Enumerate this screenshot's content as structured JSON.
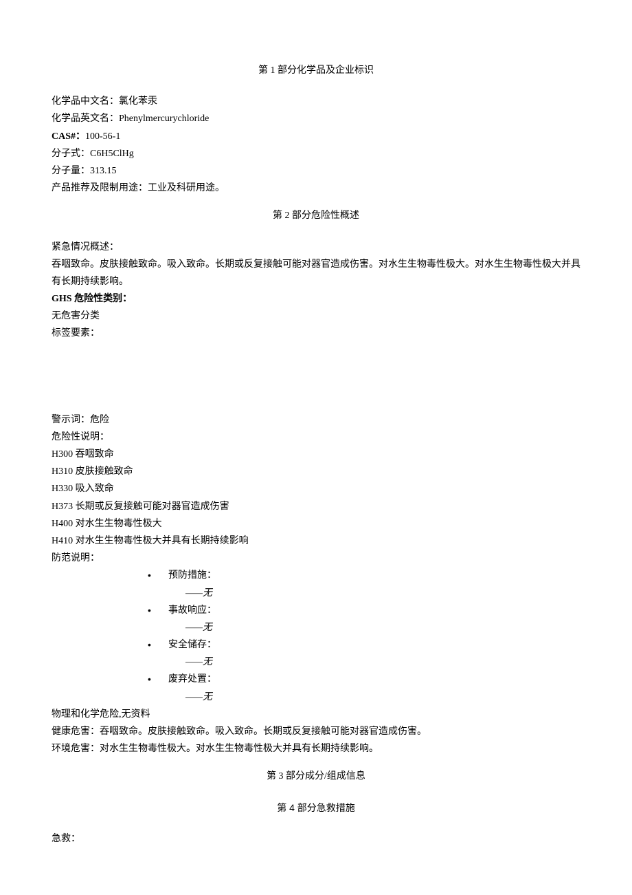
{
  "section1": {
    "title": "第 1 部分化学品及企业标识",
    "chineseName": {
      "label": "化学品中文名：",
      "value": "氯化苯汞"
    },
    "englishName": {
      "label": "化学品英文名：",
      "value": "Phenylmercurychloride"
    },
    "cas": {
      "label": "CAS#：",
      "value": "100-56-1"
    },
    "formula": {
      "label": "分子式：",
      "value": "C6H5ClHg"
    },
    "weight": {
      "label": "分子量：",
      "value": "313.15"
    },
    "usage": {
      "label": "产品推荐及限制用途：",
      "value": "工业及科研用途。"
    }
  },
  "section2": {
    "title": "第 2 部分危险性概述",
    "emergencyLabel": "紧急情况概述：",
    "emergencyText": "吞咽致命。皮肤接触致命。吸入致命。长期或反复接触可能对器官造成伤害。对水生生物毒性极大。对水生生物毒性极大并具有长期持续影响。",
    "ghsLabel": "GHS 危险性类别：",
    "ghsText": "无危害分类",
    "labelElement": "标签要素：",
    "signalWord": {
      "label": "警示词：",
      "value": "危险"
    },
    "hazardLabel": "危险性说明：",
    "hazards": [
      "H300 吞咽致命",
      "H310 皮肤接触致命",
      "H330 吸入致命",
      "H373 长期或反复接触可能对器官造成伤害",
      "H400 对水生生物毒性极大",
      "H410 对水生生物毒性极大并具有长期持续影响"
    ],
    "precautionLabel": "防范说明：",
    "precautions": [
      {
        "label": "预防措施：",
        "value": "——无"
      },
      {
        "label": "事故响应：",
        "value": "——无"
      },
      {
        "label": "安全储存：",
        "value": "——无"
      },
      {
        "label": "废弃处置：",
        "value": "——无"
      }
    ],
    "physical": "物理和化学危险,无资料",
    "health": {
      "label": "健康危害：",
      "value": "吞咽致命。皮肤接触致命。吸入致命。长期或反复接触可能对器官造成伤害。"
    },
    "environment": {
      "label": "环境危害：",
      "value": "对水生生物毒性极大。对水生生物毒性极大并具有长期持续影响。"
    }
  },
  "section3": {
    "title": "第 3 部分成分/组成信息"
  },
  "section4": {
    "title": "第 4 部分急救措施",
    "firstAidLabel": "急救："
  }
}
